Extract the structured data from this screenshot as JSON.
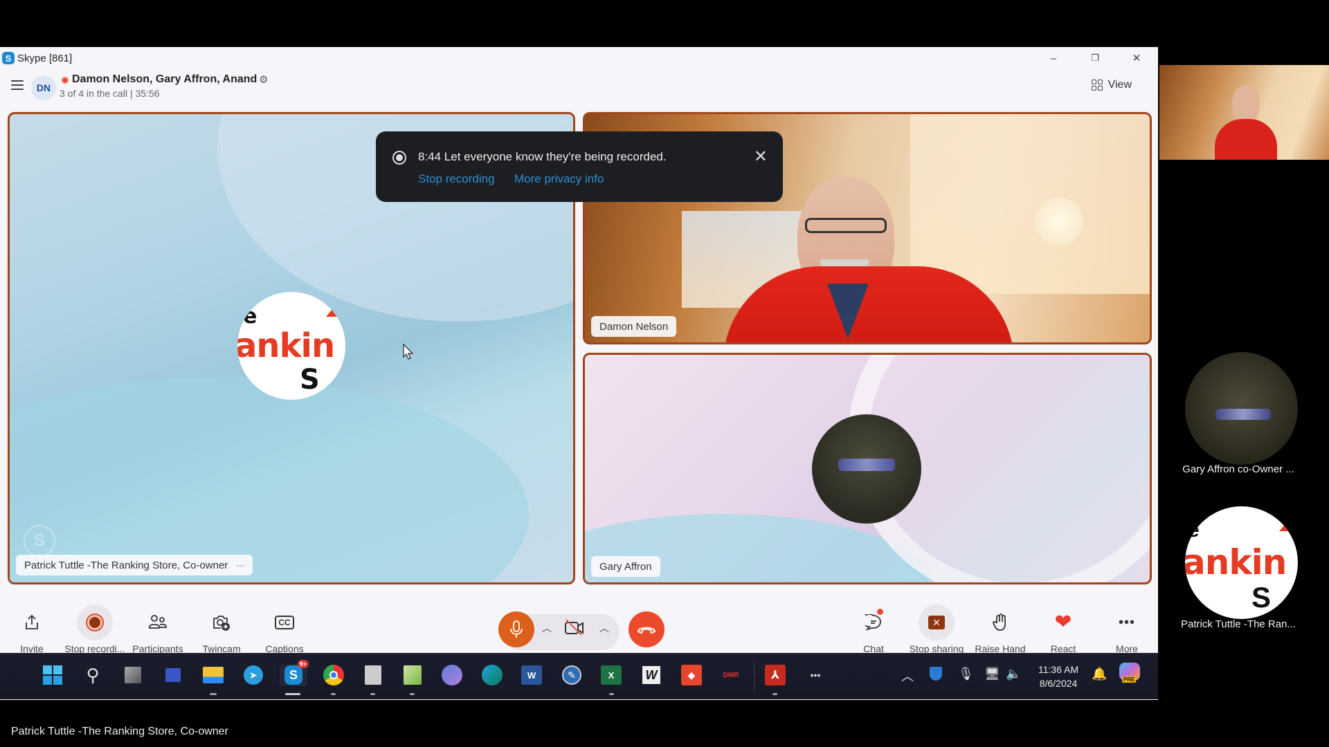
{
  "window": {
    "app_title": "Skype [861]",
    "controls": {
      "minimize": "–",
      "restore": "❐",
      "close": "✕"
    }
  },
  "call_header": {
    "avatar_initials": "DN",
    "title": "Damon Nelson, Gary Affron, Anand",
    "subtitle": "3 of 4 in the call | 35:56",
    "recording": true,
    "view_label": "View"
  },
  "toast": {
    "message": "8:44 Let everyone know they're being recorded.",
    "stop_recording_link": "Stop recording",
    "privacy_link": "More privacy info"
  },
  "tiles": [
    {
      "name": "Patrick Tuttle -The Ranking Store, Co-owner",
      "more": "···",
      "video": "avatar-logo"
    },
    {
      "name": "Damon Nelson",
      "video": "camera"
    },
    {
      "name": "Gary Affron",
      "video": "avatar-photo"
    }
  ],
  "toolbar": {
    "left": [
      {
        "label": "Invite",
        "icon": "share-icon"
      },
      {
        "label": "Stop recordi...",
        "icon": "record-icon",
        "active": true
      },
      {
        "label": "Participants",
        "icon": "participants-icon"
      },
      {
        "label": "Twincam",
        "icon": "twincam-icon"
      },
      {
        "label": "Captions",
        "icon": "captions-icon"
      }
    ],
    "center": {
      "mic": "unmuted",
      "camera": "off",
      "end_call": "hang-up"
    },
    "right": [
      {
        "label": "Chat",
        "icon": "chat-icon",
        "badge": true
      },
      {
        "label": "Stop sharing",
        "icon": "stop-sharing-icon",
        "active": true
      },
      {
        "label": "Raise Hand",
        "icon": "hand-icon"
      },
      {
        "label": "React",
        "icon": "heart-icon"
      },
      {
        "label": "More",
        "icon": "more-icon"
      }
    ],
    "colors": {
      "accent": "#dc5f1c",
      "end_call": "#ec4a2d",
      "recording": "#8e3510"
    }
  },
  "taskbar": {
    "apps": [
      "windows-start",
      "search",
      "task-view",
      "remote-desktop",
      "file-explorer",
      "telegram",
      "skype",
      "chrome",
      "snipping-tool",
      "notepad-plus",
      "clipchamp",
      "edge",
      "word",
      "scrivener-tools",
      "excel",
      "wordweb",
      "anydesk",
      "dmr",
      "acrobat",
      "overflow"
    ],
    "skype_badge": "9+",
    "time": "11:36 AM",
    "date": "8/6/2024",
    "copilot_badge": "PRE"
  },
  "side_panel": {
    "participants": [
      {
        "name": "Gary Affron co-Owner ..."
      },
      {
        "name": "Patrick Tuttle -The Ran..."
      }
    ]
  },
  "caption": "Patrick Tuttle -The Ranking Store, Co-owner"
}
